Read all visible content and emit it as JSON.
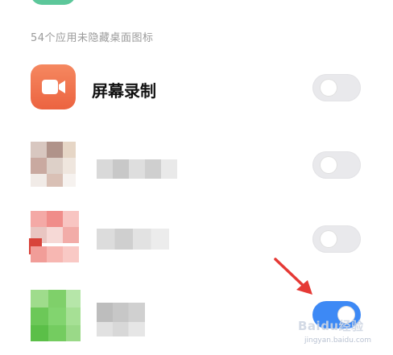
{
  "section": {
    "header": "54个应用未隐藏桌面图标"
  },
  "apps": [
    {
      "name": "屏幕录制",
      "icon": "video-camera-icon",
      "toggle_on": false
    },
    {
      "name": "",
      "icon": "blurred-app-icon",
      "toggle_on": false
    },
    {
      "name": "",
      "icon": "blurred-app-icon",
      "toggle_on": false
    },
    {
      "name": "",
      "icon": "blurred-app-icon",
      "toggle_on": true
    }
  ],
  "colors": {
    "screen_recorder_icon": "#f0704a",
    "toggle_off": "#e9e9ec",
    "toggle_on": "#3d89f5",
    "arrow": "#e53935"
  },
  "watermark": {
    "logo": "Baidu经验",
    "url": "jingyan.baidu.com"
  }
}
